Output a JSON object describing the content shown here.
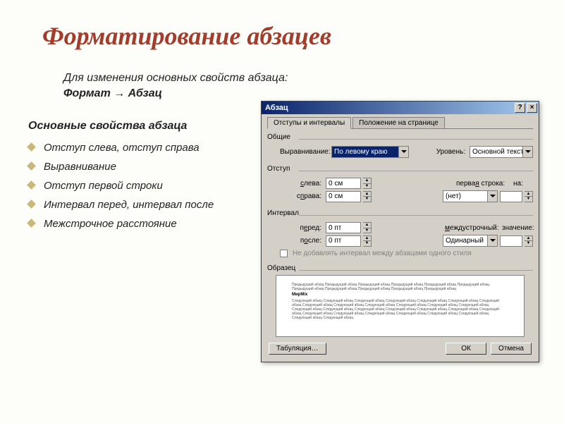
{
  "slide": {
    "title": "Форматирование абзацев",
    "intro_line1": "Для изменения основных свойств абзаца:",
    "intro_path": "Формат → Абзац",
    "subhead": "Основные свойства абзаца",
    "bullets": [
      "Отступ слева, отступ справа",
      "Выравнивание",
      "Отступ первой строки",
      "Интервал перед, интервал после",
      "Межстрочное расстояние"
    ]
  },
  "dialog": {
    "title": "Абзац",
    "help_symbol": "?",
    "close_symbol": "×",
    "tabs": {
      "tab1": "Отступы и интервалы",
      "tab2": "Положение на странице"
    },
    "general": {
      "group": "Общие",
      "alignment_label": "Выравнивание:",
      "alignment_value": "По левому краю",
      "level_label": "Уровень:",
      "level_value": "Основной текст"
    },
    "indent": {
      "group": "Отступ",
      "left_label": "слева:",
      "left_value": "0 см",
      "right_label": "справа:",
      "right_value": "0 см",
      "firstline_label": "первая строка:",
      "firstline_value": "(нет)",
      "by_label": "на:",
      "by_value": ""
    },
    "spacing": {
      "group": "Интервал",
      "before_label": "перед:",
      "before_value": "0 пт",
      "after_label": "после:",
      "after_value": "0 пт",
      "line_label": "междустрочный:",
      "line_value": "Одинарный",
      "at_label": "значение:",
      "at_value": "",
      "checkbox": "Не добавлять интервал между абзацами одного стиля"
    },
    "preview": {
      "group": "Образец",
      "lorem_prev": "Предыдущий абзац Предыдущий абзац Предыдущий абзац Предыдущий абзац Предыдущий абзац Предыдущий абзац Предыдущий абзац Предыдущий абзац Предыдущий абзац Предыдущий абзац Предыдущий абзац",
      "lorem_bold": "МирМix",
      "lorem_next": "Следующий абзац Следующий абзац Следующий абзац Следующий абзац Следующий абзац Следующий абзац Следующий абзац Следующий абзац Следующий абзац Следующий абзац Следующий абзац Следующий абзац Следующий абзац Следующий абзац Следующий абзац Следующий абзац Следующий абзац Следующий абзац Следующий абзац Следующий абзац Следующий абзац Следующий абзац Следующий абзац Следующий абзац Следующий абзац Следующий абзац Следующий абзац Следующий абзац"
    },
    "buttons": {
      "tabs": "Табуляция…",
      "ok": "ОК",
      "cancel": "Отмена"
    }
  }
}
